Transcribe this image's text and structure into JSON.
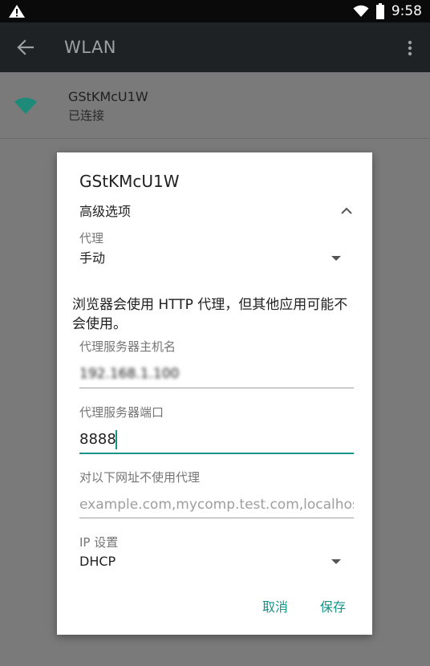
{
  "status_bar": {
    "time": "9:58",
    "icons": [
      "warning-icon",
      "wifi-icon",
      "battery-icon"
    ]
  },
  "app_bar": {
    "title": "WLAN",
    "icons": [
      "back-arrow-icon",
      "overflow-menu-icon"
    ]
  },
  "network": {
    "name": "GStKMcU1W",
    "status": "已连接",
    "icon": "wifi-signal-icon"
  },
  "dialog": {
    "title": "GStKMcU1W",
    "advanced_options_label": "高级选项",
    "proxy": {
      "label": "代理",
      "value": "手动"
    },
    "proxy_note": "浏览器会使用 HTTP 代理，但其他应用可能不会使用。",
    "proxy_host": {
      "label": "代理服务器主机名",
      "value": "192.168.1.100"
    },
    "proxy_port": {
      "label": "代理服务器端口",
      "value": "8888"
    },
    "bypass": {
      "label": "对以下网址不使用代理",
      "placeholder": "example.com,mycomp.test.com,localhost"
    },
    "ip_settings": {
      "label": "IP 设置",
      "value": "DHCP"
    },
    "buttons": {
      "cancel": "取消",
      "save": "保存"
    }
  },
  "colors": {
    "accent": "#159488",
    "wifi_icon": "#1e8a78",
    "app_bar": "#1f2224",
    "status_bar": "#0a0a0a",
    "scrim": "#7a7a7a"
  }
}
